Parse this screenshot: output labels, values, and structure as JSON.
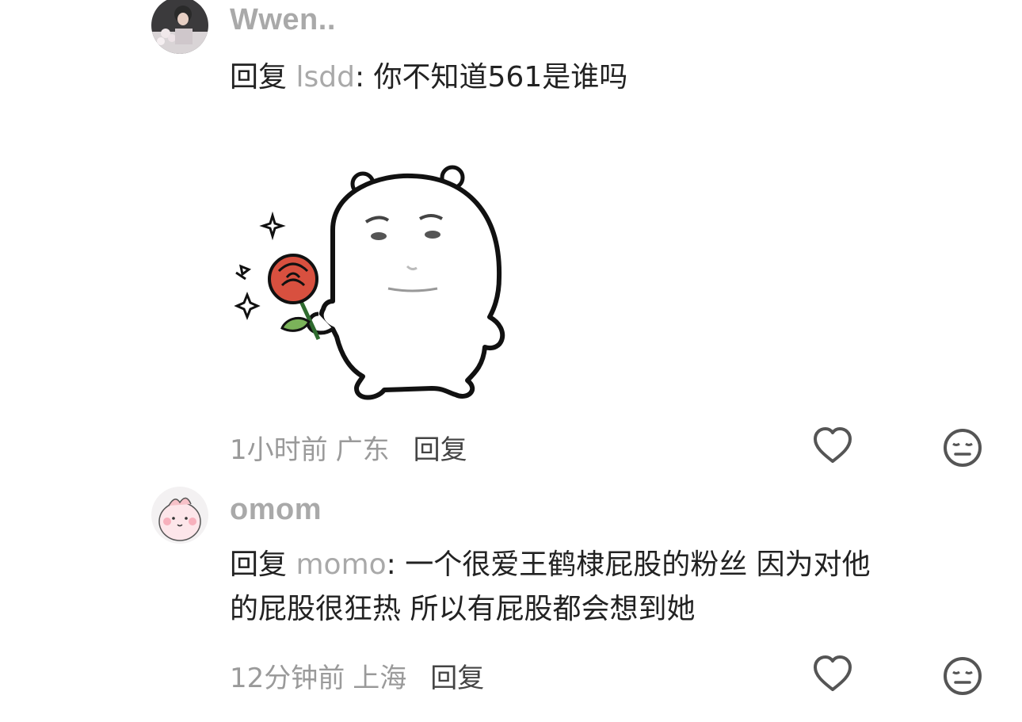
{
  "comments": [
    {
      "username": "Wwen..",
      "reply_word": "回复",
      "mention": "lsdd",
      "separator": ":",
      "text": " 你不知道561是谁吗",
      "sticker": "bear-holding-rose-sticker",
      "time": "1小时前",
      "location": "广东",
      "reply_label": "回复",
      "like_icon": "heart-outline-icon",
      "dislike_icon": "meh-face-icon"
    },
    {
      "username": "omom",
      "reply_word": "回复",
      "mention": "momo",
      "separator": ":",
      "text_line1": " 一个很爱王鹤棣屁股的粉丝 因为对他",
      "text_line2": "的屁股很狂热 所以有屁股都会想到她",
      "time": "12分钟前",
      "location": "上海",
      "reply_label": "回复",
      "like_icon": "heart-outline-icon",
      "dislike_icon": "meh-face-icon"
    }
  ],
  "colors": {
    "text": "#222222",
    "muted": "#a9a9a9",
    "icon": "#555555"
  }
}
